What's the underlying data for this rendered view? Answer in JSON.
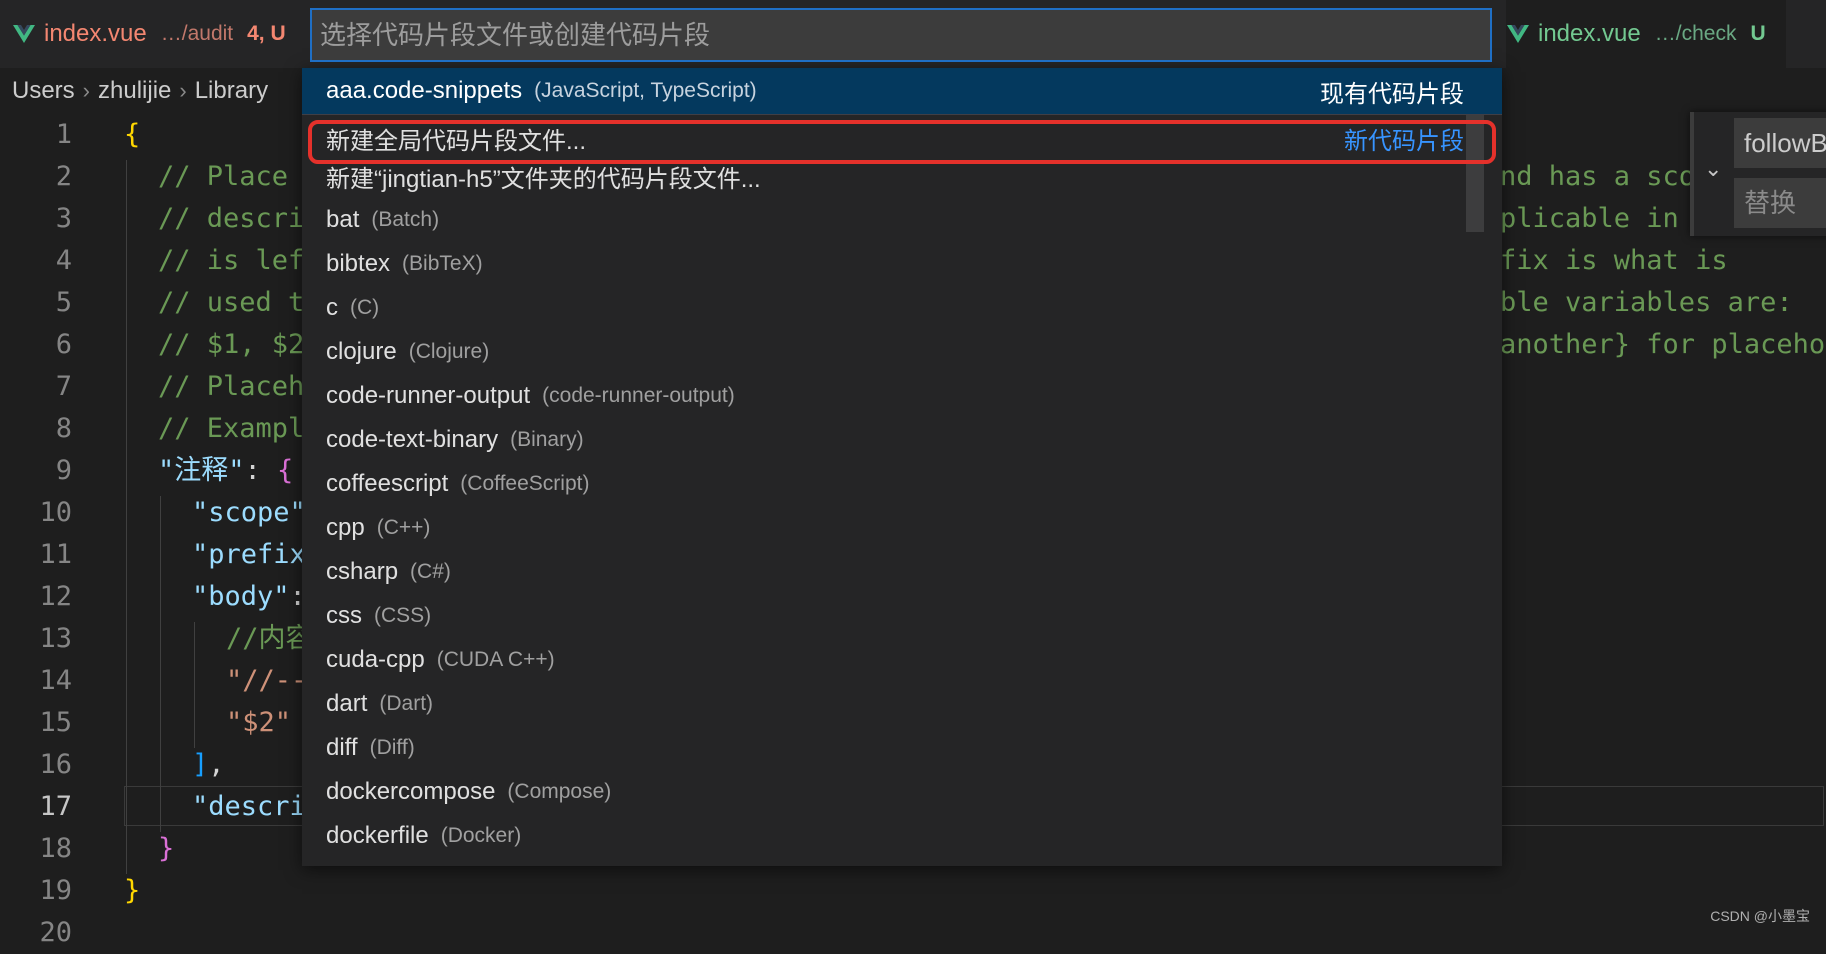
{
  "tabs": {
    "left": {
      "name": "index.vue",
      "path": "…/audit",
      "badge": "4, U"
    },
    "right": {
      "name": "index.vue",
      "path": "…/check",
      "badge": "U"
    }
  },
  "breadcrumb": [
    "Users",
    "zhulijie",
    "Library"
  ],
  "editor": {
    "lines": [
      {
        "n": "1",
        "segments": [
          {
            "t": "{",
            "c": "c-brace"
          }
        ],
        "indent": 0
      },
      {
        "n": "2",
        "segments": [
          {
            "t": "// Place",
            "c": "c-cmt"
          }
        ],
        "indent": 1
      },
      {
        "n": "3",
        "segments": [
          {
            "t": "// descri",
            "c": "c-cmt"
          }
        ],
        "indent": 1
      },
      {
        "n": "4",
        "segments": [
          {
            "t": "// is lef",
            "c": "c-cmt"
          }
        ],
        "indent": 1
      },
      {
        "n": "5",
        "segments": [
          {
            "t": "// used t",
            "c": "c-cmt"
          }
        ],
        "indent": 1
      },
      {
        "n": "6",
        "segments": [
          {
            "t": "// $1, $2",
            "c": "c-cmt"
          }
        ],
        "indent": 1
      },
      {
        "n": "7",
        "segments": [
          {
            "t": "// Placeh",
            "c": "c-cmt"
          }
        ],
        "indent": 1
      },
      {
        "n": "8",
        "segments": [
          {
            "t": "// Exampl",
            "c": "c-cmt"
          }
        ],
        "indent": 1
      },
      {
        "n": "9",
        "segments": [
          {
            "t": "\"注释\"",
            "c": "c-key"
          },
          {
            "t": ": ",
            "c": ""
          },
          {
            "t": "{",
            "c": "c-brace2"
          }
        ],
        "indent": 1
      },
      {
        "n": "10",
        "segments": [
          {
            "t": "\"scope\"",
            "c": "c-key"
          }
        ],
        "indent": 2
      },
      {
        "n": "11",
        "segments": [
          {
            "t": "\"prefix",
            "c": "c-key"
          }
        ],
        "indent": 2
      },
      {
        "n": "12",
        "segments": [
          {
            "t": "\"body\"",
            "c": "c-key"
          },
          {
            "t": ":",
            "c": ""
          }
        ],
        "indent": 2
      },
      {
        "n": "13",
        "segments": [
          {
            "t": "//内容",
            "c": "c-cmt"
          }
        ],
        "indent": 3
      },
      {
        "n": "14",
        "segments": [
          {
            "t": "\"//--",
            "c": "c-str"
          }
        ],
        "indent": 3
      },
      {
        "n": "15",
        "segments": [
          {
            "t": "\"$2\"",
            "c": "c-str"
          }
        ],
        "indent": 3
      },
      {
        "n": "16",
        "segments": [
          {
            "t": "]",
            "c": "c-brace3"
          },
          {
            "t": ",",
            "c": ""
          }
        ],
        "indent": 2
      },
      {
        "n": "17",
        "segments": [
          {
            "t": "\"descri",
            "c": "c-key"
          }
        ],
        "indent": 2
      },
      {
        "n": "18",
        "segments": [
          {
            "t": "}",
            "c": "c-brace2"
          }
        ],
        "indent": 1
      },
      {
        "n": "19",
        "segments": [
          {
            "t": "}",
            "c": "c-brace"
          }
        ],
        "indent": 0
      },
      {
        "n": "20",
        "segments": [],
        "indent": 0
      }
    ],
    "current_line": "17",
    "right_fragments": [
      {
        "line": "2",
        "text": "nd has a sco"
      },
      {
        "line": "3",
        "text": "plicable in"
      },
      {
        "line": "4",
        "text": "fix is what is"
      },
      {
        "line": "5",
        "text": "ble variables are:"
      },
      {
        "line": "6",
        "text": "another} for placeho"
      }
    ]
  },
  "find_widget": {
    "find_value": "followB",
    "replace_placeholder": "替换"
  },
  "quick_pick": {
    "placeholder": "选择代码片段文件或创建代码片段",
    "items": [
      {
        "label": "aaa.code-snippets",
        "desc": "(JavaScript, TypeScript)",
        "sep": "现有代码片段",
        "active": true
      },
      {
        "label": "新建全局代码片段文件...",
        "desc": "",
        "sep": "新代码片段",
        "highlighted": true
      },
      {
        "label": "新建“jingtian-h5”文件夹的代码片段文件...",
        "desc": ""
      },
      {
        "label": "bat",
        "desc": "(Batch)"
      },
      {
        "label": "bibtex",
        "desc": "(BibTeX)"
      },
      {
        "label": "c",
        "desc": "(C)"
      },
      {
        "label": "clojure",
        "desc": "(Clojure)"
      },
      {
        "label": "code-runner-output",
        "desc": "(code-runner-output)"
      },
      {
        "label": "code-text-binary",
        "desc": "(Binary)"
      },
      {
        "label": "coffeescript",
        "desc": "(CoffeeScript)"
      },
      {
        "label": "cpp",
        "desc": "(C++)"
      },
      {
        "label": "csharp",
        "desc": "(C#)"
      },
      {
        "label": "css",
        "desc": "(CSS)"
      },
      {
        "label": "cuda-cpp",
        "desc": "(CUDA C++)"
      },
      {
        "label": "dart",
        "desc": "(Dart)"
      },
      {
        "label": "diff",
        "desc": "(Diff)"
      },
      {
        "label": "dockercompose",
        "desc": "(Compose)"
      },
      {
        "label": "dockerfile",
        "desc": "(Docker)"
      }
    ]
  },
  "watermark": "CSDN @小墨宝",
  "colors": {
    "accent": "#1f6fc5",
    "active_row": "#04395e",
    "highlight": "#e5312b"
  }
}
